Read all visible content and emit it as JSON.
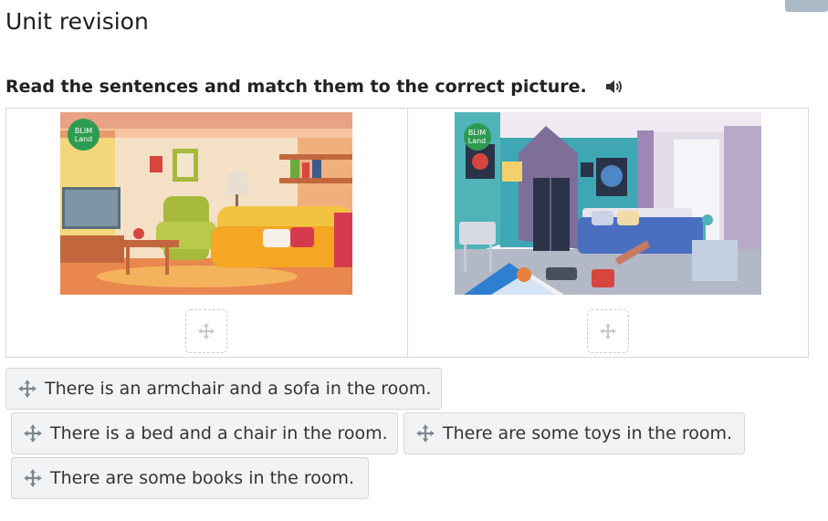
{
  "page": {
    "title": "Unit revision"
  },
  "instructions": {
    "text": "Read the sentences and match them to the correct picture."
  },
  "icons": {
    "speaker": "speaker-icon",
    "move": "move-arrows-icon"
  },
  "pictures": [
    {
      "logo_line1": "BLIM",
      "logo_line2": "Land"
    },
    {
      "logo_line1": "BLIM",
      "logo_line2": "Land"
    }
  ],
  "options": [
    "There is an armchair and a sofa in the room.",
    "There is a bed and a chair in the room.",
    "There are some toys in the room.",
    "There are some books in the room."
  ],
  "colors": {
    "accent": "#a9b9c6",
    "chip_bg": "#f2f3f5",
    "border": "#d5d9dd"
  }
}
